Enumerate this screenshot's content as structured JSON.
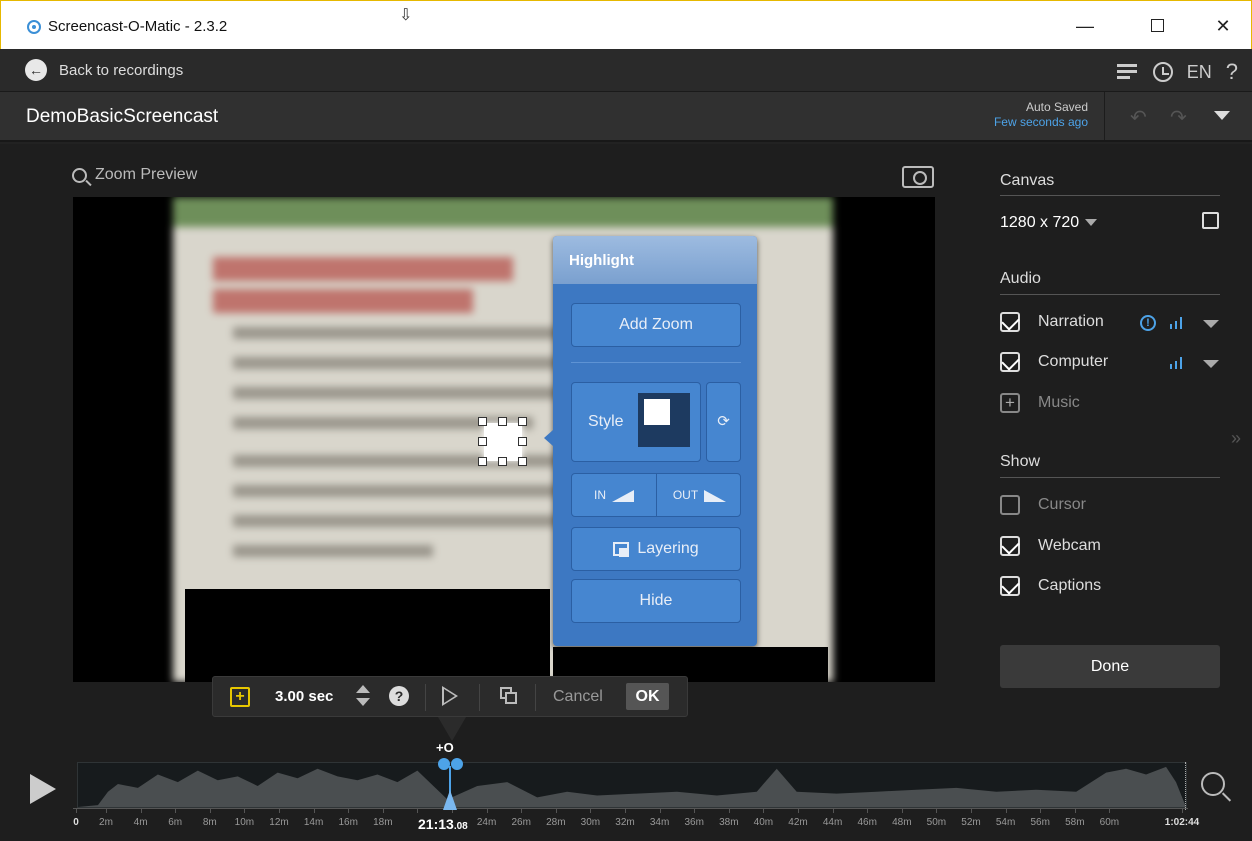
{
  "window": {
    "title": "Screencast-O-Matic - 2.3.2"
  },
  "nav": {
    "back_label": "Back to recordings",
    "language": "EN",
    "help": "?"
  },
  "project": {
    "name": "DemoBasicScreencast",
    "autosave_label": "Auto Saved",
    "autosave_time": "Few seconds ago"
  },
  "preview": {
    "zoom_preview_label": "Zoom Preview"
  },
  "highlight_popup": {
    "title": "Highlight",
    "add_zoom": "Add Zoom",
    "style_label": "Style",
    "in_label": "IN",
    "out_label": "OUT",
    "layering": "Layering",
    "hide": "Hide"
  },
  "toolbar": {
    "duration": "3.00 sec",
    "cancel": "Cancel",
    "ok": "OK"
  },
  "panel": {
    "canvas_title": "Canvas",
    "canvas_size": "1280 x 720",
    "audio_title": "Audio",
    "narration": "Narration",
    "computer": "Computer",
    "music": "Music",
    "show_title": "Show",
    "cursor": "Cursor",
    "webcam": "Webcam",
    "captions": "Captions",
    "done": "Done"
  },
  "timeline": {
    "marker_label": "+O",
    "playhead_time_main": "21:13",
    "playhead_time_frac": ".08",
    "ticks": [
      "0",
      "2m",
      "4m",
      "6m",
      "8m",
      "10m",
      "12m",
      "14m",
      "16m",
      "18m",
      "",
      "",
      "24m",
      "26m",
      "28m",
      "30m",
      "32m",
      "34m",
      "36m",
      "38m",
      "40m",
      "42m",
      "44m",
      "46m",
      "48m",
      "50m",
      "52m",
      "54m",
      "56m",
      "58m",
      "60m",
      "1:02:44"
    ]
  },
  "colors": {
    "accent": "#4da3e8",
    "popup": "#3d78c2",
    "zoom_yellow": "#e6c600"
  }
}
